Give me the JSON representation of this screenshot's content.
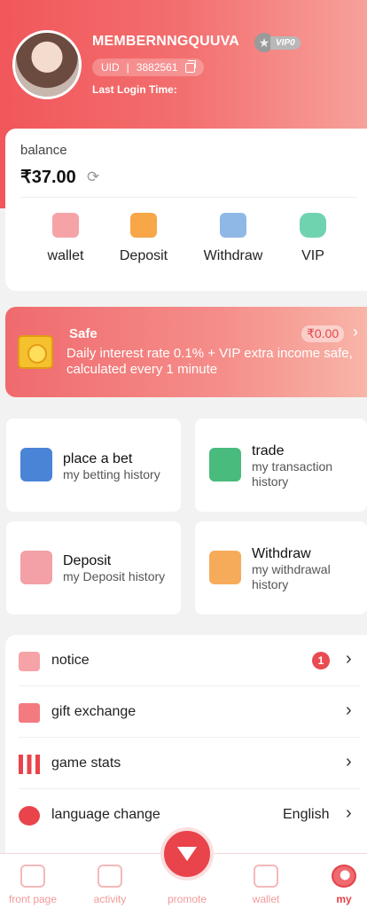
{
  "profile": {
    "username": "MEMBERNNGQUUVA",
    "vip_level": "VIP0",
    "uid_label": "UID",
    "uid_separator": "|",
    "uid_value": "3882561",
    "last_login_label": "Last Login Time:"
  },
  "balance": {
    "label": "balance",
    "amount": "₹37.00",
    "actions": [
      {
        "label": "wallet",
        "icon": "wallet-icon"
      },
      {
        "label": "Deposit",
        "icon": "deposit-icon"
      },
      {
        "label": "Withdraw",
        "icon": "withdraw-icon"
      },
      {
        "label": "VIP",
        "icon": "vip-icon"
      }
    ]
  },
  "safe": {
    "title": "Safe",
    "amount": "₹0.00",
    "description": "Daily interest rate 0.1% + VIP extra income safe, calculated every 1 minute"
  },
  "history": [
    {
      "title": "place a bet",
      "subtitle": "my betting history"
    },
    {
      "title": "trade",
      "subtitle": "my transaction history"
    },
    {
      "title": "Deposit",
      "subtitle": "my Deposit history"
    },
    {
      "title": "Withdraw",
      "subtitle": "my withdrawal history"
    }
  ],
  "menu": {
    "notice": {
      "label": "notice",
      "badge": "1"
    },
    "gift": {
      "label": "gift exchange"
    },
    "stats": {
      "label": "game stats"
    },
    "language": {
      "label": "language change",
      "value": "English"
    }
  },
  "tabs": {
    "front": "front page",
    "activity": "activity",
    "promote": "promote",
    "wallet": "wallet",
    "my": "my"
  },
  "colors": {
    "accent": "#e9444b",
    "header_start": "#f1575b",
    "header_end": "#f7a19b"
  }
}
